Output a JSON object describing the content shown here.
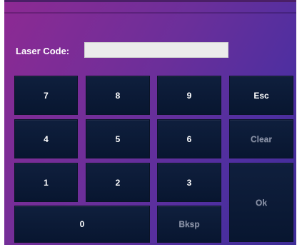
{
  "laser_code": {
    "label": "Laser Code:",
    "value": ""
  },
  "keys": {
    "k7": "7",
    "k8": "8",
    "k9": "9",
    "esc": "Esc",
    "k4": "4",
    "k5": "5",
    "k6": "6",
    "clear": "Clear",
    "k1": "1",
    "k2": "2",
    "k3": "3",
    "ok": "Ok",
    "k0": "0",
    "bksp": "Bksp"
  },
  "colors": {
    "button": "#0c1b36",
    "disabled_text": "#8b93a8",
    "gradient_left": "#8d2a93",
    "gradient_right": "#3e2d97"
  }
}
